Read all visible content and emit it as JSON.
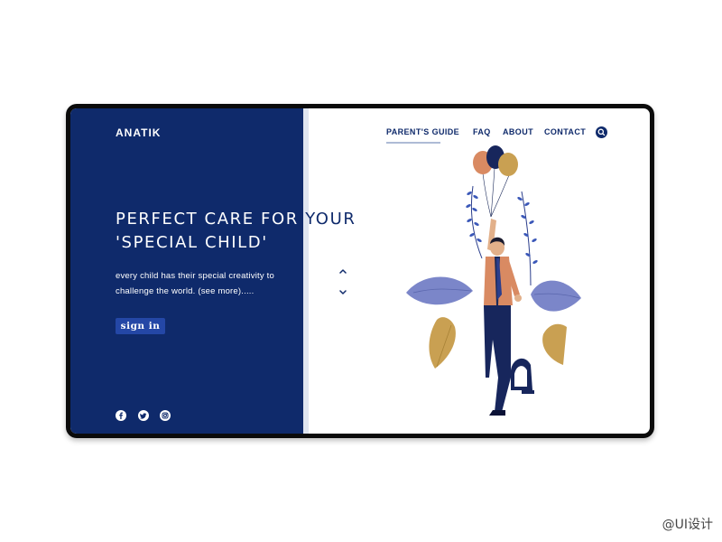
{
  "header": {
    "logo": "ANATIK",
    "nav": [
      {
        "label": "PARENT'S GUIDE",
        "active": true
      },
      {
        "label": "FAQ",
        "active": false
      },
      {
        "label": "ABOUT",
        "active": false
      },
      {
        "label": "CONTACT",
        "active": false
      }
    ],
    "search_icon": "search-icon"
  },
  "hero": {
    "headline_line1_light": "PERFECT CARE FOR ",
    "headline_line1_dark": "YOUR",
    "headline_line2": "'SPECIAL CHILD'",
    "description_line1": "every child has their special creativity to",
    "description_line2": "challenge the world. (see more).....",
    "signin_label": "sign in"
  },
  "social": [
    "facebook-icon",
    "twitter-icon",
    "instagram-icon"
  ],
  "carousel": {
    "up_icon": "chevron-up-icon",
    "down_icon": "chevron-down-icon"
  },
  "watermark": "@UI设计",
  "colors": {
    "brand_navy": "#0f2a6b",
    "button_blue": "#2447a6",
    "balloon_orange": "#d98a62",
    "balloon_gold": "#c9a052",
    "leaf_purple": "#7b86c9"
  }
}
